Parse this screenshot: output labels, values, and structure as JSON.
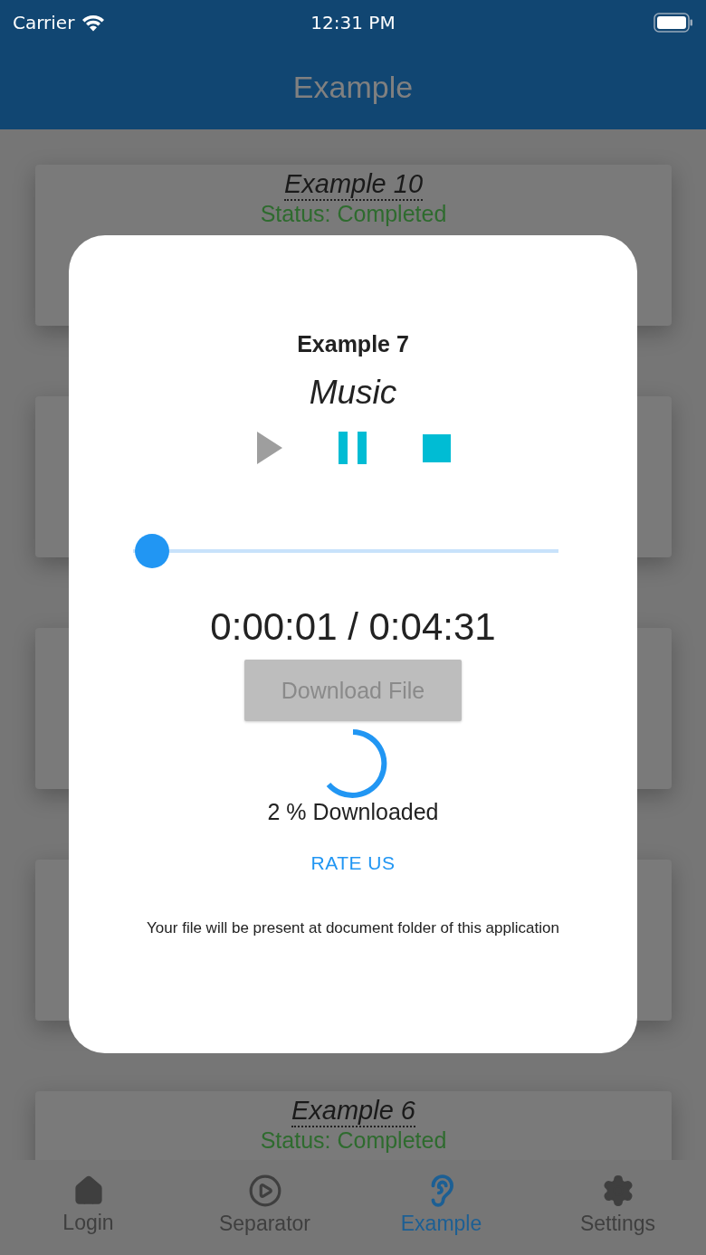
{
  "status_bar": {
    "carrier": "Carrier",
    "time": "12:31 PM"
  },
  "header": {
    "title": "Example"
  },
  "cards": [
    {
      "kind": "text",
      "title": "Example 10",
      "status": "Status: Completed"
    },
    {
      "kind": "covered"
    },
    {
      "kind": "covered"
    },
    {
      "kind": "covered"
    },
    {
      "kind": "text",
      "title": "Example 6",
      "status": "Status: Completed"
    }
  ],
  "dialog": {
    "title": "Example 7",
    "subtitle": "Music",
    "controls": [
      {
        "kind": "play",
        "disabled": true
      },
      {
        "kind": "pause",
        "disabled": false
      },
      {
        "kind": "stop",
        "disabled": false
      }
    ],
    "seek": {
      "level": 0.004
    },
    "time": "0:00:01 / 0:04:31",
    "download_button": {
      "label": "Download File",
      "disabled": true
    },
    "progress_text": "2 % Downloaded",
    "rate_link": "RATE US",
    "note": "Your file will be present at document folder of this application"
  },
  "tabs": [
    {
      "label": "Login",
      "selected": false
    },
    {
      "label": "Separator",
      "selected": false
    },
    {
      "label": "Example",
      "selected": true
    },
    {
      "label": "Settings",
      "selected": false
    }
  ]
}
